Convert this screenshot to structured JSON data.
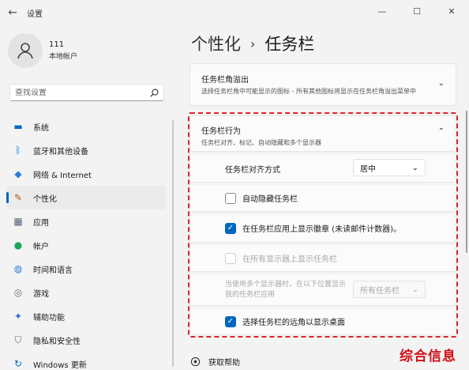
{
  "window": {
    "title": "设置",
    "back_glyph": "←",
    "minimize_glyph": "—",
    "maximize_glyph": "☐",
    "close_glyph": "✕"
  },
  "profile": {
    "name": "111",
    "subtitle": "本地帐户"
  },
  "search": {
    "placeholder": "查找设置"
  },
  "sidebar": {
    "items": [
      {
        "label": "系统",
        "icon": "monitor-icon",
        "glyph": "▬"
      },
      {
        "label": "蓝牙和其他设备",
        "icon": "bluetooth-icon",
        "glyph": "ᛒ"
      },
      {
        "label": "网络 & Internet",
        "icon": "wifi-icon",
        "glyph": "◆"
      },
      {
        "label": "个性化",
        "icon": "pen-icon",
        "glyph": "✎"
      },
      {
        "label": "应用",
        "icon": "apps-icon",
        "glyph": "▦"
      },
      {
        "label": "帐户",
        "icon": "person-icon",
        "glyph": "●"
      },
      {
        "label": "时间和语言",
        "icon": "clock-globe-icon",
        "glyph": "◍"
      },
      {
        "label": "游戏",
        "icon": "gamepad-icon",
        "glyph": "◎"
      },
      {
        "label": "辅助功能",
        "icon": "accessibility-icon",
        "glyph": "✦"
      },
      {
        "label": "隐私和安全性",
        "icon": "shield-icon",
        "glyph": "⛉"
      },
      {
        "label": "Windows 更新",
        "icon": "update-icon",
        "glyph": "↻"
      }
    ],
    "active_index": 3
  },
  "breadcrumb": {
    "parent": "个性化",
    "separator": "›",
    "current": "任务栏"
  },
  "overflow_card": {
    "title": "任务栏角溢出",
    "desc": "选择任务栏角中可能显示的图标 - 所有其他图标将显示在任务栏角溢出菜单中",
    "chevron": "⌄"
  },
  "behavior_card": {
    "title": "任务栏行为",
    "desc": "任务栏对齐、标记、自动隐藏和多个显示器",
    "chevron": "⌃"
  },
  "behaviors": {
    "alignment_label": "任务栏对齐方式",
    "alignment_value": "居中",
    "autohide_label": "自动隐藏任务栏",
    "badges_label": "在任务栏应用上显示徽章 (未读邮件计数器)。",
    "all_displays_label": "在所有显示器上显示任务栏",
    "multi_display_label": "当使用多个显示器时，在以下位置显示我的任务栏应用",
    "multi_display_value": "所有任务栏",
    "far_corner_label": "选择任务栏的远角以显示桌面",
    "dropdown_glyph": "⌄",
    "check_glyph": "✓"
  },
  "help": {
    "label": "获取帮助"
  },
  "watermark": "综合信息",
  "colors": {
    "accent": "#0067c0",
    "highlight": "#e0252f"
  }
}
